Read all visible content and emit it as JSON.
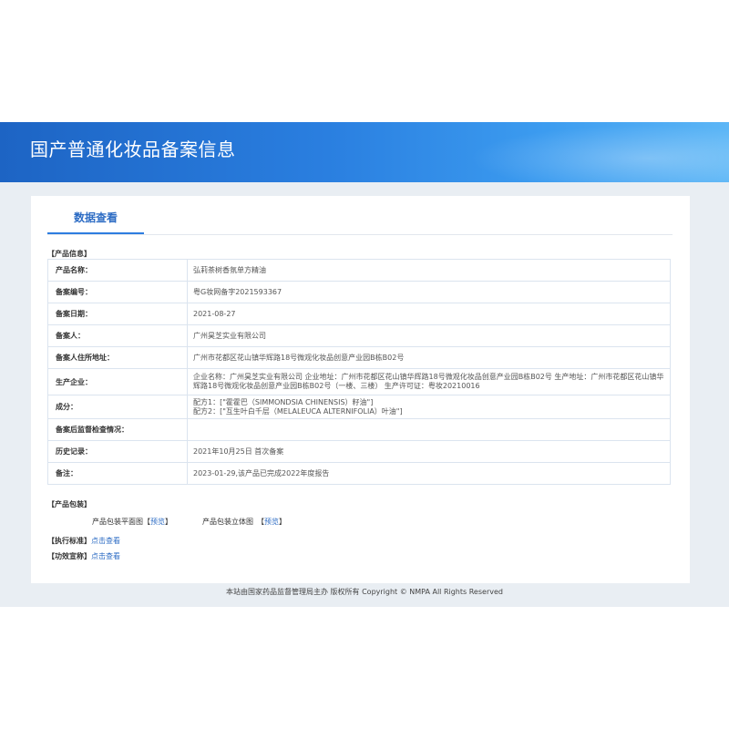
{
  "header": {
    "title": "国产普通化妆品备案信息"
  },
  "tabs": [
    {
      "label": "数据查看"
    }
  ],
  "product_info": {
    "section_label": "【产品信息】",
    "rows": [
      {
        "key": "产品名称：",
        "value": "弘莉茶树香氛单方精油"
      },
      {
        "key": "备案编号：",
        "value": "粤G妆网备字2021593367"
      },
      {
        "key": "备案日期：",
        "value": "2021-08-27"
      },
      {
        "key": "备案人：",
        "value": "广州昊芝实业有限公司"
      },
      {
        "key": "备案人住所地址：",
        "value": "广州市花都区花山镇华辉路18号微观化妆品创意产业园B栋B02号"
      },
      {
        "key": "生产企业：",
        "value": "企业名称：广州昊芝实业有限公司 企业地址：广州市花都区花山镇华辉路18号微观化妆品创意产业园B栋B02号 生产地址：广州市花都区花山镇华辉路18号微观化妆品创意产业园B栋B02号（一楼、三楼） 生产许可证：粤妆20210016"
      },
      {
        "key": "成分：",
        "value_lines": [
          "配方1：[\"霍霍巴（SIMMONDSIA CHINENSIS）籽油\"]",
          "配方2：[\"互生叶白千层（MELALEUCA ALTERNIFOLIA）叶油\"]"
        ]
      },
      {
        "key": "备案后监督检查情况：",
        "value": ""
      },
      {
        "key": "历史记录：",
        "value": "2021年10月25日 首次备案"
      },
      {
        "key": "备注：",
        "value": "2023-01-29,该产品已完成2022年度报告"
      }
    ]
  },
  "packaging": {
    "section_label": "【产品包装】",
    "flat_label": "产品包装平面图",
    "solid_label": "产品包装立体图",
    "bracket_open": "【",
    "bracket_close": "】",
    "preview_label": "预览"
  },
  "standard": {
    "section_label": "【执行标准】",
    "link": "点击查看"
  },
  "efficacy": {
    "section_label": "【功效宣称】",
    "link": "点击查看"
  },
  "footer": {
    "text": "本站由国家药品监督管理局主办 版权所有 Copyright © NMPA All Rights Reserved"
  }
}
